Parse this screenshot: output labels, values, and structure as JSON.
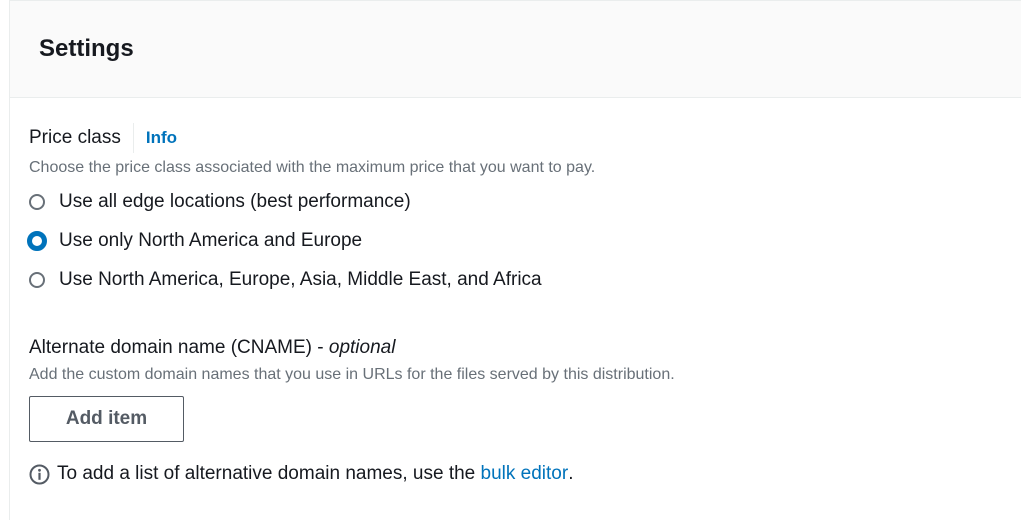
{
  "settings": {
    "title": "Settings"
  },
  "price_class": {
    "label": "Price class",
    "info_link": "Info",
    "description": "Choose the price class associated with the maximum price that you want to pay.",
    "options": [
      {
        "label": "Use all edge locations (best performance)",
        "selected": false
      },
      {
        "label": "Use only North America and Europe",
        "selected": true
      },
      {
        "label": "Use North America, Europe, Asia, Middle East, and Africa",
        "selected": false
      }
    ]
  },
  "cname": {
    "label": "Alternate domain name (CNAME) - ",
    "optional": "optional",
    "description": "Add the custom domain names that you use in URLs for the files served by this distribution.",
    "add_button": "Add item",
    "hint_prefix": "To add a list of alternative domain names, use the ",
    "hint_link": "bulk editor",
    "hint_suffix": "."
  },
  "colors": {
    "accent": "#0073bb",
    "text": "#16191f",
    "secondary_text": "#687078",
    "header_bg": "#fafafa"
  },
  "icons": {
    "info": "info-circle-icon"
  }
}
